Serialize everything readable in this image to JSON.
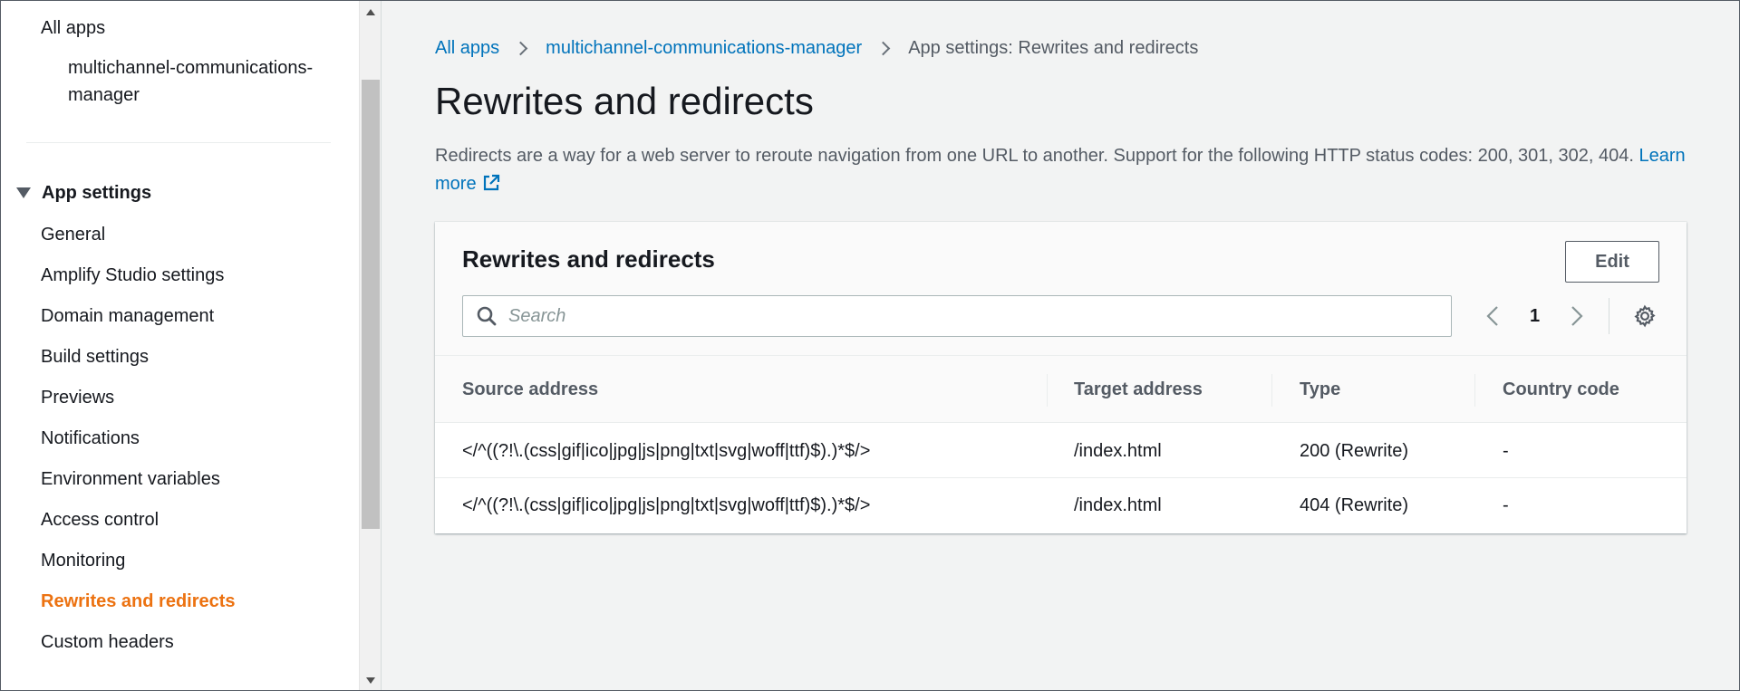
{
  "sidebar": {
    "all_apps": "All apps",
    "app_name": "multichannel-communications-manager",
    "section_title": "App settings",
    "items": [
      {
        "label": "General"
      },
      {
        "label": "Amplify Studio settings"
      },
      {
        "label": "Domain management"
      },
      {
        "label": "Build settings"
      },
      {
        "label": "Previews"
      },
      {
        "label": "Notifications"
      },
      {
        "label": "Environment variables"
      },
      {
        "label": "Access control"
      },
      {
        "label": "Monitoring"
      },
      {
        "label": "Rewrites and redirects",
        "active": true
      },
      {
        "label": "Custom headers"
      }
    ]
  },
  "breadcrumb": {
    "root": "All apps",
    "app": "multichannel-communications-manager",
    "current": "App settings: Rewrites and redirects"
  },
  "page": {
    "title": "Rewrites and redirects",
    "description": "Redirects are a way for a web server to reroute navigation from one URL to another. Support for the following HTTP status codes: 200, 301, 302, 404.",
    "learn_more": "Learn more"
  },
  "table": {
    "title": "Rewrites and redirects",
    "edit_label": "Edit",
    "search_placeholder": "Search",
    "current_page": "1",
    "columns": [
      "Source address",
      "Target address",
      "Type",
      "Country code"
    ],
    "rows": [
      {
        "source": "</^((?!\\.(css|gif|ico|jpg|js|png|txt|svg|woff|ttf)$).)*$/>",
        "target": "/index.html",
        "type": "200 (Rewrite)",
        "country": "-"
      },
      {
        "source": "</^((?!\\.(css|gif|ico|jpg|js|png|txt|svg|woff|ttf)$).)*$/>",
        "target": "/index.html",
        "type": "404 (Rewrite)",
        "country": "-"
      }
    ]
  },
  "colors": {
    "link": "#0073bb",
    "active_nav": "#ec7211",
    "text": "#16191f",
    "muted": "#545b64"
  }
}
